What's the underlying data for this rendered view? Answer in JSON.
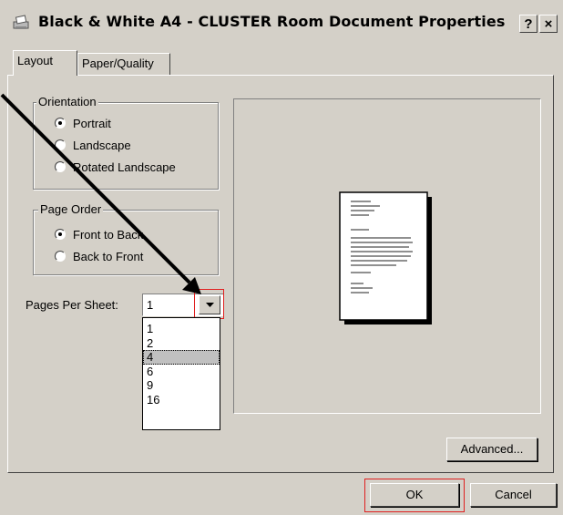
{
  "window": {
    "title": "Black & White A4 - CLUSTER Room Document Properties",
    "help_glyph": "?",
    "close_glyph": "×",
    "icon": "printer-icon"
  },
  "tabs": [
    {
      "label": "Layout",
      "active": true
    },
    {
      "label": "Paper/Quality",
      "active": false
    }
  ],
  "orientation": {
    "legend": "Orientation",
    "options": [
      "Portrait",
      "Landscape",
      "Rotated Landscape"
    ],
    "selected": "Portrait"
  },
  "page_order": {
    "legend": "Page Order",
    "options": [
      "Front to Back",
      "Back to Front"
    ],
    "selected": "Front to Back"
  },
  "pages_per_sheet": {
    "label": "Pages Per Sheet:",
    "value": "1",
    "options": [
      "1",
      "2",
      "4",
      "6",
      "9",
      "16"
    ],
    "highlighted": "4"
  },
  "buttons": {
    "advanced": "Advanced...",
    "ok": "OK",
    "cancel": "Cancel"
  },
  "annotation": {
    "color": "#e02020",
    "arrow_color": "#000000"
  }
}
